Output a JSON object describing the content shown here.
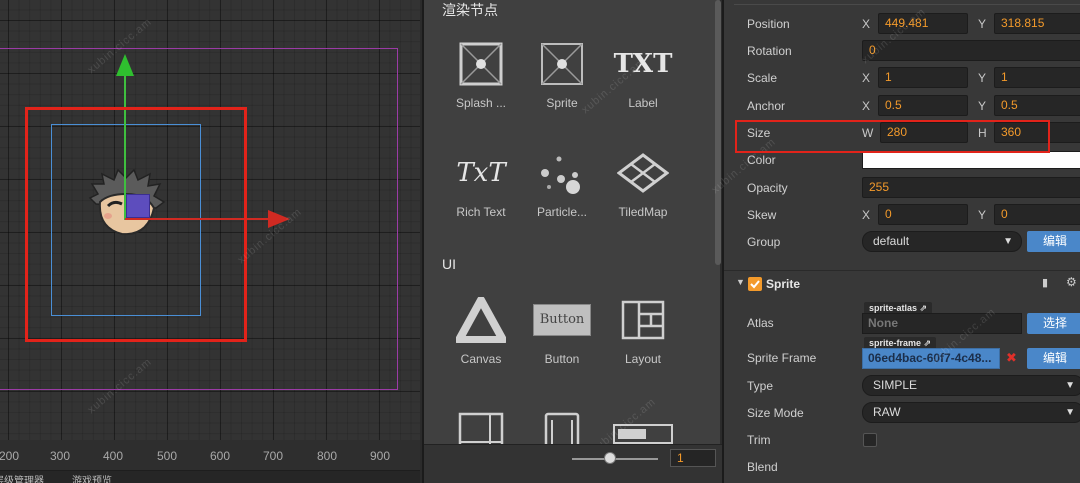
{
  "scene": {
    "ruler_ticks": [
      "200",
      "300",
      "400",
      "500",
      "600",
      "700",
      "800",
      "900"
    ],
    "tabs": [
      "层级管理器",
      "游戏预览"
    ]
  },
  "library": {
    "section_render": "渲染节点",
    "section_ui": "UI",
    "items": [
      {
        "label": "Splash ...",
        "icon": "splash-sprite-icon"
      },
      {
        "label": "Sprite",
        "icon": "sprite-icon"
      },
      {
        "label": "Label",
        "icon": "label-icon",
        "glyph": "TXT"
      },
      {
        "label": "Rich Text",
        "icon": "rich-text-icon",
        "glyph": "TxT"
      },
      {
        "label": "Particle...",
        "icon": "particle-system-icon"
      },
      {
        "label": "TiledMap",
        "icon": "tiledmap-icon"
      },
      {
        "label": "Canvas",
        "icon": "canvas-icon"
      },
      {
        "label": "Button",
        "icon": "button-icon",
        "glyph": "Button"
      },
      {
        "label": "Layout",
        "icon": "layout-icon"
      }
    ],
    "zoom_value": "1"
  },
  "props": {
    "position": {
      "label": "Position",
      "x_label": "X",
      "x": "449.481",
      "y_label": "Y",
      "y": "318.815"
    },
    "rotation": {
      "label": "Rotation",
      "value": "0"
    },
    "scale": {
      "label": "Scale",
      "x_label": "X",
      "x": "1",
      "y_label": "Y",
      "y": "1"
    },
    "anchor": {
      "label": "Anchor",
      "x_label": "X",
      "x": "0.5",
      "y_label": "Y",
      "y": "0.5"
    },
    "size": {
      "label": "Size",
      "w_label": "W",
      "w": "280",
      "h_label": "H",
      "h": "360"
    },
    "color": {
      "label": "Color",
      "value": "#ffffff"
    },
    "opacity": {
      "label": "Opacity",
      "value": "255"
    },
    "skew": {
      "label": "Skew",
      "x_label": "X",
      "x": "0",
      "y_label": "Y",
      "y": "0"
    },
    "group": {
      "label": "Group",
      "value": "default",
      "edit_label": "编辑"
    },
    "sprite": {
      "title": "Sprite",
      "atlas": {
        "label": "Atlas",
        "tag": "sprite-atlas",
        "value": "None",
        "select_label": "选择"
      },
      "frame": {
        "label": "Sprite Frame",
        "tag": "sprite-frame",
        "value": "06ed4bac-60f7-4c48...",
        "edit_label": "编辑"
      },
      "type": {
        "label": "Type",
        "value": "SIMPLE"
      },
      "size_mode": {
        "label": "Size Mode",
        "value": "RAW"
      },
      "trim": {
        "label": "Trim"
      },
      "blend": {
        "label": "Blend"
      }
    }
  },
  "watermark": "xubin.cicc.am"
}
